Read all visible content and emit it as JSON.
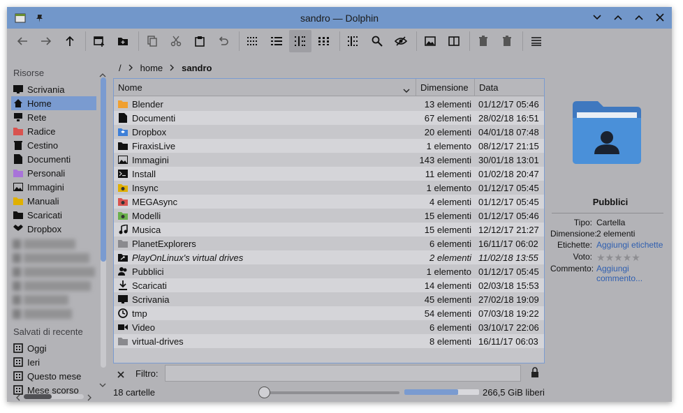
{
  "window": {
    "title": "sandro — Dolphin"
  },
  "toolbar": {
    "buttons": [
      {
        "icon": "back-icon"
      },
      {
        "icon": "forward-icon"
      },
      {
        "icon": "up-icon"
      },
      {
        "icon": "new-window-icon"
      },
      {
        "icon": "new-folder-icon"
      },
      {
        "icon": "copy-icon"
      },
      {
        "icon": "cut-icon"
      },
      {
        "icon": "paste-icon"
      },
      {
        "icon": "undo-icon"
      },
      {
        "icon": "icons-view-icon"
      },
      {
        "icon": "compact-view-icon"
      },
      {
        "icon": "details-view-icon"
      },
      {
        "icon": "grid-view-icon"
      },
      {
        "icon": "columns-view-icon"
      },
      {
        "icon": "search-icon"
      },
      {
        "icon": "hidden-files-icon"
      },
      {
        "icon": "preview-icon"
      },
      {
        "icon": "split-view-icon"
      },
      {
        "icon": "trash-icon"
      },
      {
        "icon": "delete-icon"
      },
      {
        "icon": "menu-icon"
      }
    ]
  },
  "sidebar": {
    "resources_title": "Risorse",
    "resources": [
      {
        "label": "Scrivania",
        "icon": "desktop-icon"
      },
      {
        "label": "Home",
        "icon": "home-icon",
        "selected": true
      },
      {
        "label": "Rete",
        "icon": "network-icon"
      },
      {
        "label": "Radice",
        "icon": "root-icon",
        "color": "#d9534f"
      },
      {
        "label": "Cestino",
        "icon": "trash-icon"
      },
      {
        "label": "Documenti",
        "icon": "document-icon"
      },
      {
        "label": "Personali",
        "icon": "folder-icon",
        "color": "#a873d9"
      },
      {
        "label": "Immagini",
        "icon": "image-icon"
      },
      {
        "label": "Manuali",
        "icon": "folder-icon",
        "color": "#e0b000"
      },
      {
        "label": "Scaricati",
        "icon": "folder-icon"
      },
      {
        "label": "Dropbox",
        "icon": "dropbox-icon"
      }
    ],
    "recent_title": "Salvati di recente",
    "recent": [
      {
        "label": "Oggi",
        "icon": "calendar-today-icon"
      },
      {
        "label": "Ieri",
        "icon": "calendar-yesterday-icon"
      },
      {
        "label": "Questo mese",
        "icon": "calendar-month-icon"
      },
      {
        "label": "Mese scorso",
        "icon": "calendar-lastmonth-icon"
      }
    ]
  },
  "breadcrumb": {
    "root": "/",
    "items": [
      "home",
      "sandro"
    ]
  },
  "table": {
    "headers": {
      "name": "Nome",
      "size": "Dimensione",
      "date": "Data"
    },
    "rows": [
      {
        "name": "Blender",
        "size": "13 elementi",
        "date": "01/12/17 05:46",
        "icon": "folder-icon",
        "color": "#f0a030"
      },
      {
        "name": "Documenti",
        "size": "67 elementi",
        "date": "28/02/18 16:51",
        "icon": "document-folder-icon",
        "color": "#111111"
      },
      {
        "name": "Dropbox",
        "size": "20 elementi",
        "date": "04/01/18 07:48",
        "icon": "dropbox-folder-icon",
        "color": "#3d7fd8"
      },
      {
        "name": "FiraxisLive",
        "size": "1 elemento",
        "date": "08/12/17 21:15",
        "icon": "folder-icon",
        "color": "#111111"
      },
      {
        "name": "Immagini",
        "size": "143 elementi",
        "date": "30/01/18 13:01",
        "icon": "image-folder-icon",
        "color": "#111111"
      },
      {
        "name": "Install",
        "size": "11 elementi",
        "date": "01/02/18 20:47",
        "icon": "terminal-folder-icon",
        "color": "#111111"
      },
      {
        "name": "Insync",
        "size": "1 elemento",
        "date": "01/12/17 05:45",
        "icon": "insync-folder-icon",
        "color": "#e0b000"
      },
      {
        "name": "MEGAsync",
        "size": "4 elementi",
        "date": "01/12/17 05:45",
        "icon": "mega-folder-icon",
        "color": "#d9534f"
      },
      {
        "name": "Modelli",
        "size": "15 elementi",
        "date": "01/12/17 05:46",
        "icon": "templates-folder-icon",
        "color": "#6ab04c"
      },
      {
        "name": "Musica",
        "size": "15 elementi",
        "date": "12/12/17 21:27",
        "icon": "music-icon",
        "color": "#111111"
      },
      {
        "name": "PlanetExplorers",
        "size": "6 elementi",
        "date": "16/11/17 06:02",
        "icon": "folder-icon",
        "color": "#8a8a8e"
      },
      {
        "name": "PlayOnLinux's virtual drives",
        "size": "2 elementi",
        "date": "11/02/18 13:55",
        "icon": "link-folder-icon",
        "color": "#111111",
        "italic": true
      },
      {
        "name": "Pubblici",
        "size": "1 elemento",
        "date": "01/12/17 05:45",
        "icon": "public-folder-icon",
        "color": "#111111"
      },
      {
        "name": "Scaricati",
        "size": "14 elementi",
        "date": "02/03/18 15:53",
        "icon": "download-icon",
        "color": "#111111"
      },
      {
        "name": "Scrivania",
        "size": "45 elementi",
        "date": "27/02/18 19:09",
        "icon": "desktop-icon",
        "color": "#111111"
      },
      {
        "name": "tmp",
        "size": "54 elementi",
        "date": "07/03/18 19:22",
        "icon": "clock-icon",
        "color": "#111111"
      },
      {
        "name": "Video",
        "size": "6 elementi",
        "date": "03/10/17 22:06",
        "icon": "video-icon",
        "color": "#111111"
      },
      {
        "name": "virtual-drives",
        "size": "8 elementi",
        "date": "16/11/17 06:03",
        "icon": "folder-icon",
        "color": "#8a8a8e"
      }
    ]
  },
  "filter": {
    "label": "Filtro:",
    "value": ""
  },
  "status": {
    "count": "18 cartelle",
    "free": "266,5 GiB liberi",
    "zoom_fraction": 0.0,
    "disk_used_fraction": 0.72
  },
  "info": {
    "name": "Pubblici",
    "type_label": "Tipo:",
    "type_value": "Cartella",
    "size_label": "Dimensione:",
    "size_value": "2 elementi",
    "tags_label": "Etichette:",
    "tags_value": "Aggiungi etichette",
    "rating_label": "Voto:",
    "rating_value": 0,
    "comment_label": "Commento:",
    "comment_value_1": "Aggiungi",
    "comment_value_2": "commento..."
  },
  "colors": {
    "accent": "#7a9bd0",
    "titlebar": "#7297ca",
    "folder": "#4a90d9"
  }
}
